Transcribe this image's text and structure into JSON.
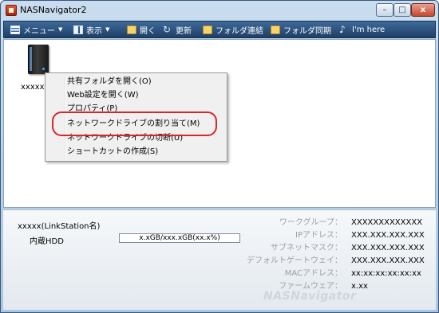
{
  "window": {
    "title": "NASNavigator2"
  },
  "titlebar_buttons": {
    "minimize": "–",
    "maximize": "□",
    "close": "x"
  },
  "toolbar": {
    "items": [
      {
        "label": "メニュー",
        "icon": "menu-icon",
        "has_dropdown": true
      },
      {
        "label": "表示",
        "icon": "view-icon",
        "has_dropdown": true
      },
      {
        "label": "開く",
        "icon": "folder-icon"
      },
      {
        "label": "更新",
        "icon": "refresh-icon"
      },
      {
        "label": "フォルダ連結",
        "icon": "folder-icon"
      },
      {
        "label": "フォルダ同期",
        "icon": "folder-icon"
      },
      {
        "label": "I'm here",
        "icon": "note-icon"
      }
    ]
  },
  "device": {
    "label": "xxxxx(l"
  },
  "context_menu": {
    "items": [
      "共有フォルダを開く(O)",
      "Web設定を開く(W)",
      "プロパティ(P)",
      "ネットワークドライブの割り当て(M)",
      "ネットワークドライブの切断(U)",
      "ショートカットの作成(S)"
    ],
    "highlighted_index": 3,
    "highlight_color": "#d8262b"
  },
  "info": {
    "name": "xxxxx(LinkStation名)",
    "hdd_label": "内蔵HDD",
    "hdd_usage": "x.xGB/xxx.xGB(xx.x%)",
    "rows": [
      {
        "key": "ワークグループ：",
        "value": "XXXXXXXXXXXXX"
      },
      {
        "key": "IPアドレス：",
        "value": "XXX.XXX.XXX.XXX"
      },
      {
        "key": "サブネットマスク：",
        "value": "XXX.XXX.XXX.XXX"
      },
      {
        "key": "デフォルトゲートウェイ：",
        "value": "XXX.XXX.XXX.XXX"
      },
      {
        "key": "MACアドレス：",
        "value": "xx:xx:xx:xx:xx:xx"
      },
      {
        "key": "ファームウェア：",
        "value": "x.xx"
      }
    ],
    "watermark": "NASNavigator"
  },
  "colors": {
    "toolbar": "#1e3f66",
    "frame": "#aac6e2"
  }
}
